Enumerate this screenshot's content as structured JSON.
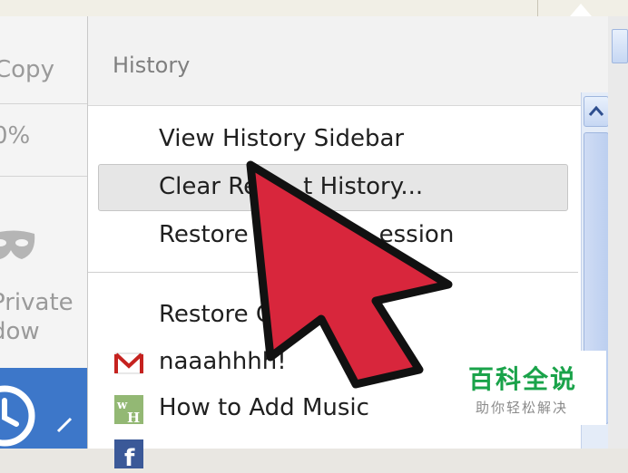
{
  "left_menu": {
    "copy_label": "Copy",
    "zoom_label": "0%",
    "private_label_1": "Private",
    "private_label_2": "dow",
    "mask_icon": "private-mask-icon",
    "history_icon": "clock-icon"
  },
  "history_menu": {
    "title": "History",
    "view_sidebar": "View History Sidebar",
    "clear_recent": "Clear Re",
    "clear_recent_tail": "t History...",
    "restore_session_head": "Restore P",
    "restore_session_tail": "ession",
    "restore_closed": "Restore C",
    "history_items": [
      {
        "icon": "gmail-icon",
        "label": "naaahhhh!"
      },
      {
        "icon": "wikihow-icon",
        "label": "How to Add Music"
      },
      {
        "icon": "facebook-icon",
        "label": ""
      }
    ]
  },
  "watermark": {
    "title": "百科全说",
    "subtitle": "助你轻松解决"
  },
  "colors": {
    "pointer_fill": "#d8263c",
    "accent_blue": "#3d77c9",
    "watermark_green": "#1aa34a"
  }
}
